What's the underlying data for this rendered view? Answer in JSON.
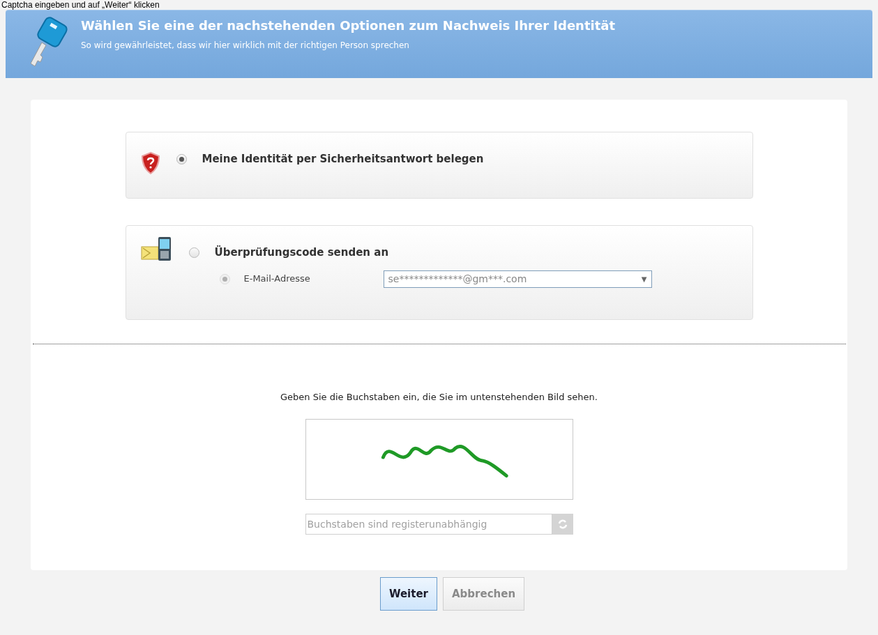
{
  "caption": "Captcha eingeben und auf „Weiter“ klicken",
  "header": {
    "title": "Wählen Sie eine der nachstehenden Optionen zum Nachweis Ihrer Identität",
    "subtitle": "So wird gewährleistet, dass wir hier wirklich mit der richtigen Person sprechen"
  },
  "options": [
    {
      "kind": "answer",
      "label": "Meine Identität per Sicherheitsantwort belegen",
      "selected": true
    },
    {
      "kind": "code",
      "label": "Überprüfungscode senden an",
      "selected": false,
      "sub_option": {
        "label": "E-Mail-Adresse",
        "selected": true,
        "disabled": true,
        "value": "se*************@gm***.com",
        "arrow": "▼"
      }
    }
  ],
  "captcha": {
    "instruction": "Geben Sie die Buchstaben ein, die Sie im untenstehenden Bild sehen.",
    "placeholder": "Buchstaben sind registerunabhängig"
  },
  "buttons": [
    {
      "label": "Weiter",
      "kind": "primary"
    },
    {
      "label": "Abbrechen",
      "kind": "secondary"
    }
  ]
}
